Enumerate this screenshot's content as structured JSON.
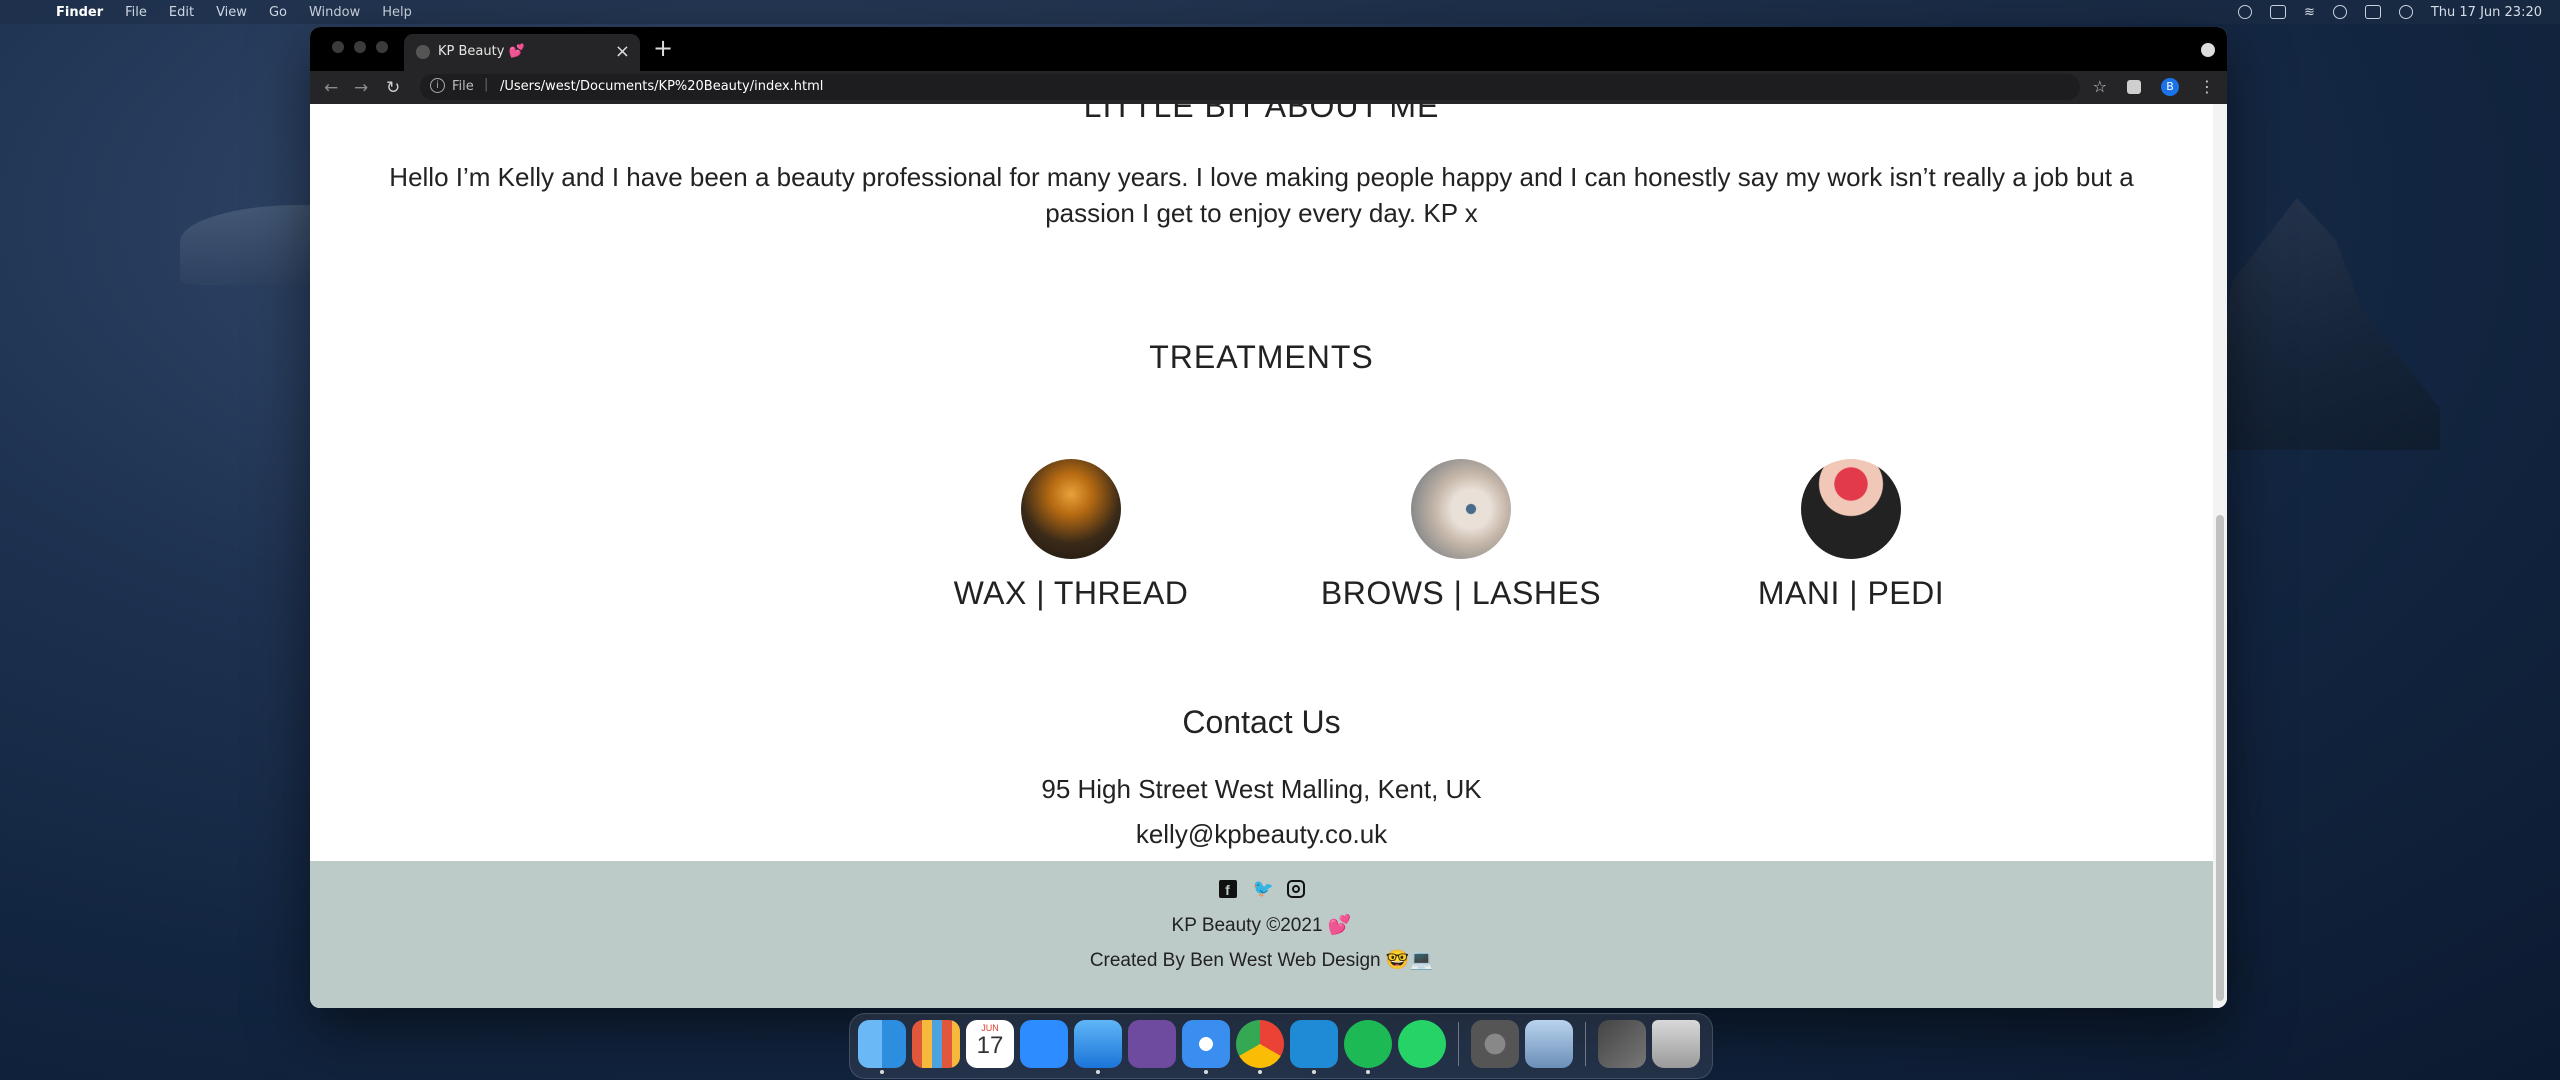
{
  "menubar": {
    "app": "Finder",
    "items": [
      "File",
      "Edit",
      "View",
      "Go",
      "Window",
      "Help"
    ],
    "clock": "Thu 17 Jun  23:20"
  },
  "browser": {
    "tab_title": "KP Beauty 💕",
    "url_scheme": "File",
    "url_path": "/Users/west/Documents/KP%20Beauty/index.html",
    "profile_initial": "B"
  },
  "page": {
    "about_heading": "LITTLE BIT ABOUT ME",
    "about_text": "Hello I’m Kelly and I have been a beauty professional for many years. I love making people happy and I can honestly say my work isn’t really a job but a passion I get to enjoy every day. KP x",
    "treatments_heading": "TREATMENTS",
    "treatments": [
      {
        "label": "WAX | THREAD"
      },
      {
        "label": "BROWS | LASHES"
      },
      {
        "label": "MANI | PEDI"
      }
    ],
    "contact_heading": "Contact Us",
    "address": "95 High Street West Malling, Kent, UK",
    "email": "kelly@kpbeauty.co.uk",
    "footer": {
      "copyright": "KP Beauty ©2021 💕",
      "credit": "Created By Ben West Web Design 🤓💻"
    }
  },
  "dock": {
    "apps": [
      "finder",
      "launchpad",
      "calendar",
      "zoom",
      "mail",
      "github-desktop",
      "safari",
      "chrome",
      "vscode",
      "spotify",
      "whatsapp",
      "system-preferences",
      "preview",
      "downloads",
      "trash"
    ],
    "calendar_day": "17",
    "calendar_month": "JUN",
    "colors": {
      "accent": "#1a73e8",
      "footer_bg": "#bccac8"
    }
  }
}
